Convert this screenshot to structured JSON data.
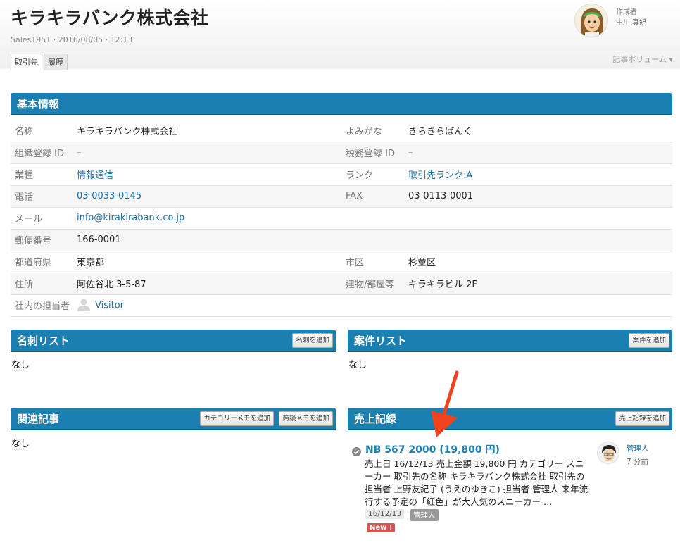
{
  "header": {
    "title": "キラキラバンク株式会社",
    "meta": "Sales1951 · 2016/08/05 · 12:13",
    "tabs": [
      "取引先",
      "履歴"
    ],
    "author_role": "作成者",
    "author_name": "中川 真紀",
    "volume_menu": "記事ボリューム ▾"
  },
  "basic_info": {
    "title": "基本情報",
    "rows": [
      {
        "l1": "名称",
        "v1": "キラキラバンク株式会社",
        "l2": "よみがな",
        "v2": "きらきらばんく"
      },
      {
        "l1": "組織登録 ID",
        "v1": "–",
        "l2": "税務登録 ID",
        "v2": "–"
      },
      {
        "l1": "業種",
        "v1": "情報通信",
        "l2": "ランク",
        "v2": "取引先ランク:A"
      },
      {
        "l1": "電話",
        "v1": "03-0033-0145",
        "l2": "FAX",
        "v2": "03-0113-0001"
      },
      {
        "l1": "メール",
        "v1": "info@kirakirabank.co.jp",
        "l2": "",
        "v2": ""
      },
      {
        "l1": "郵便番号",
        "v1": "166-0001",
        "l2": "",
        "v2": ""
      },
      {
        "l1": "都道府県",
        "v1": "東京都",
        "l2": "市区",
        "v2": "杉並区"
      },
      {
        "l1": "住所",
        "v1": "阿佐谷北 3-5-87",
        "l2": "建物/部屋等",
        "v2": "キラキラビル 2F"
      },
      {
        "l1": "社内の担当者",
        "v1": "Visitor",
        "l2": "",
        "v2": ""
      }
    ]
  },
  "cards_section": {
    "title": "名刺リスト",
    "add_button": "名刺を追加",
    "empty": "なし"
  },
  "projects_section": {
    "title": "案件リスト",
    "add_button": "案件を追加",
    "empty": "なし"
  },
  "related_section": {
    "title": "関連記事",
    "add_category_button": "カテゴリーメモを追加",
    "add_meeting_button": "商談メモを追加",
    "empty": "なし"
  },
  "sales_section": {
    "title": "売上記録",
    "add_button": "売上記録を追加",
    "entry": {
      "title": "NB 567 2000 (19,800 円)",
      "body": "売上日 16/12/13 売上金額 19,800 円 カテゴリー スニーカー 取引先の名称 キラキラバンク株式会社 取引先の担当者 上野友紀子 (うえのゆきこ) 担当者 管理人 来年流行する予定の「紅色」が大人気のスニーカー …",
      "date_tag": "16/12/13",
      "owner_tag": "管理人",
      "new_tag": "New !",
      "user": "管理人",
      "time": "7 分前"
    }
  },
  "colors": {
    "section_bar": "#1b7fb1",
    "link": "#1b6fa3",
    "new_badge": "#d9534f",
    "arrow": "#f0421c"
  },
  "icons": [
    "author-avatar",
    "person-icon",
    "check-circle-icon",
    "user-avatar",
    "red-arrow"
  ]
}
